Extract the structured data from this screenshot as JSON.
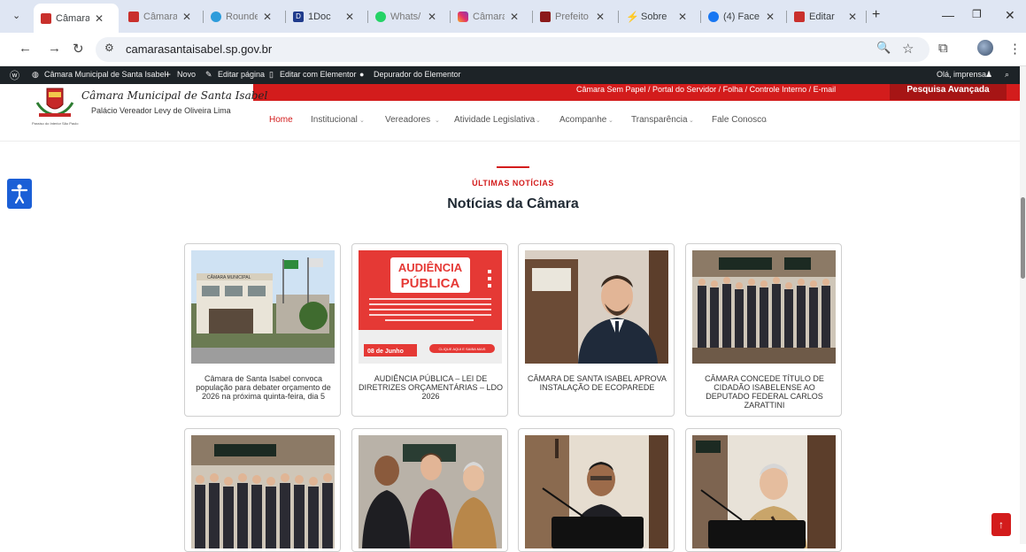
{
  "browser": {
    "tabs": [
      {
        "title": "Câmara",
        "active": true
      },
      {
        "title": "Câmara"
      },
      {
        "title": "Rounde"
      },
      {
        "title": "1Doc"
      },
      {
        "title": "Whats/"
      },
      {
        "title": "Câmara"
      },
      {
        "title": "Prefeito"
      },
      {
        "title": "Sobre"
      },
      {
        "title": "(4) Face"
      },
      {
        "title": "Editar"
      }
    ],
    "new_tab": "+",
    "url": "camarasantaisabel.sp.gov.br"
  },
  "admin_bar": {
    "site": "Câmara Municipal de Santa Isabel",
    "new": "Novo",
    "edit_page": "Editar página",
    "edit_elementor": "Editar com Elementor",
    "debugger": "Depurador do Elementor",
    "greeting": "Olá, imprensa"
  },
  "header": {
    "brand_name": "Câmara Municipal de Santa Isabel",
    "brand_sub": "Palácio Vereador Levy de Oliveira Lima",
    "brand_tiny": "Paraíso do Interior São Paulo",
    "top_links": "Câmara Sem Papel  /  Portal do Servidor  /  Folha  /  Controle Interno  /  E-mail",
    "advanced_search": "Pesquisa Avançada",
    "nav": [
      "Home",
      "Institucional",
      "Vereadores",
      "Atividade Legislativa",
      "Acompanhe",
      "Transparência",
      "Fale Conosco"
    ]
  },
  "section": {
    "kicker": "ÚLTIMAS NOTÍCIAS",
    "title": "Notícias da Câmara"
  },
  "news": [
    {
      "caption": "Câmara de Santa Isabel convoca população para debater orçamento de 2026 na próxima quinta-feira, dia 5"
    },
    {
      "caption": "AUDIÊNCIA PÚBLICA – LEI DE DIRETRIZES ORÇAMENTÁRIAS – LDO 2026"
    },
    {
      "caption": "CÂMARA DE SANTA ISABEL APROVA INSTALAÇÃO DE ECOPAREDE"
    },
    {
      "caption": "CÂMARA CONCEDE TÍTULO DE CIDADÃO ISABELENSE AO DEPUTADO FEDERAL CARLOS ZARATTINI"
    },
    {
      "caption": ""
    },
    {
      "caption": ""
    },
    {
      "caption": ""
    },
    {
      "caption": ""
    }
  ],
  "poster": {
    "title_line1": "AUDIÊNCIA",
    "title_line2": "PÚBLICA",
    "date": "08 de Junho",
    "cta": "CLIQUE AQUI E SAIBA MAIS"
  },
  "building_sign": "CÂMARA MUNICIPAL",
  "colors": {
    "brand_red": "#d31c1c",
    "admin_dark": "#1d2327",
    "access_blue": "#1b5fd6"
  }
}
